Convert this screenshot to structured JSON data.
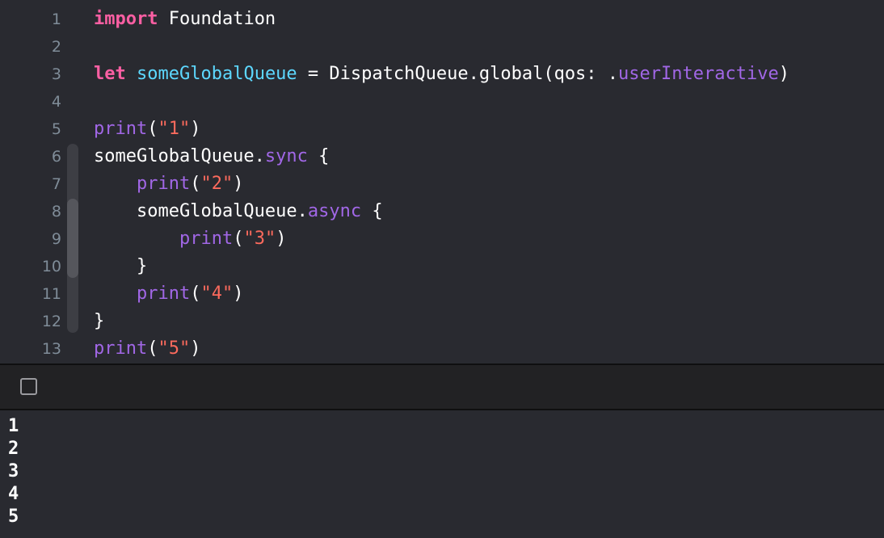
{
  "editor": {
    "lines": [
      {
        "number": "1",
        "tokens": [
          {
            "text": "import",
            "kind": "keyword"
          },
          {
            "text": " Foundation",
            "kind": "plain"
          }
        ]
      },
      {
        "number": "2",
        "tokens": []
      },
      {
        "number": "3",
        "tokens": [
          {
            "text": "let",
            "kind": "keyword"
          },
          {
            "text": " ",
            "kind": "plain"
          },
          {
            "text": "someGlobalQueue",
            "kind": "decl"
          },
          {
            "text": " = DispatchQueue.global(qos: .",
            "kind": "plain"
          },
          {
            "text": "userInteractive",
            "kind": "fn"
          },
          {
            "text": ")",
            "kind": "plain"
          }
        ]
      },
      {
        "number": "4",
        "tokens": []
      },
      {
        "number": "5",
        "tokens": [
          {
            "text": "print",
            "kind": "fn"
          },
          {
            "text": "(",
            "kind": "plain"
          },
          {
            "text": "\"1\"",
            "kind": "str"
          },
          {
            "text": ")",
            "kind": "plain"
          }
        ]
      },
      {
        "number": "6",
        "tokens": [
          {
            "text": "someGlobalQueue.",
            "kind": "plain"
          },
          {
            "text": "sync",
            "kind": "fn"
          },
          {
            "text": " {",
            "kind": "plain"
          }
        ]
      },
      {
        "number": "7",
        "tokens": [
          {
            "text": "    ",
            "kind": "plain"
          },
          {
            "text": "print",
            "kind": "fn"
          },
          {
            "text": "(",
            "kind": "plain"
          },
          {
            "text": "\"2\"",
            "kind": "str"
          },
          {
            "text": ")",
            "kind": "plain"
          }
        ]
      },
      {
        "number": "8",
        "tokens": [
          {
            "text": "    someGlobalQueue.",
            "kind": "plain"
          },
          {
            "text": "async",
            "kind": "fn"
          },
          {
            "text": " {",
            "kind": "plain"
          }
        ]
      },
      {
        "number": "9",
        "tokens": [
          {
            "text": "        ",
            "kind": "plain"
          },
          {
            "text": "print",
            "kind": "fn"
          },
          {
            "text": "(",
            "kind": "plain"
          },
          {
            "text": "\"3\"",
            "kind": "str"
          },
          {
            "text": ")",
            "kind": "plain"
          }
        ]
      },
      {
        "number": "10",
        "tokens": [
          {
            "text": "    }",
            "kind": "plain"
          }
        ]
      },
      {
        "number": "11",
        "tokens": [
          {
            "text": "    ",
            "kind": "plain"
          },
          {
            "text": "print",
            "kind": "fn"
          },
          {
            "text": "(",
            "kind": "plain"
          },
          {
            "text": "\"4\"",
            "kind": "str"
          },
          {
            "text": ")",
            "kind": "plain"
          }
        ]
      },
      {
        "number": "12",
        "tokens": [
          {
            "text": "}",
            "kind": "plain"
          }
        ]
      },
      {
        "number": "13",
        "tokens": [
          {
            "text": "print",
            "kind": "fn"
          },
          {
            "text": "(",
            "kind": "plain"
          },
          {
            "text": "\"5\"",
            "kind": "str"
          },
          {
            "text": ")",
            "kind": "plain"
          }
        ]
      }
    ]
  },
  "debug_bar": {
    "toggle_icon": "square-outline-icon"
  },
  "console": {
    "output": [
      "1",
      "2",
      "3",
      "4",
      "5"
    ]
  },
  "colors": {
    "background": "#292a30",
    "keyword": "#fc5fa3",
    "declaration": "#5dd8ff",
    "function": "#a167e6",
    "string": "#fc6a5d",
    "line_number": "#7f8c98"
  }
}
